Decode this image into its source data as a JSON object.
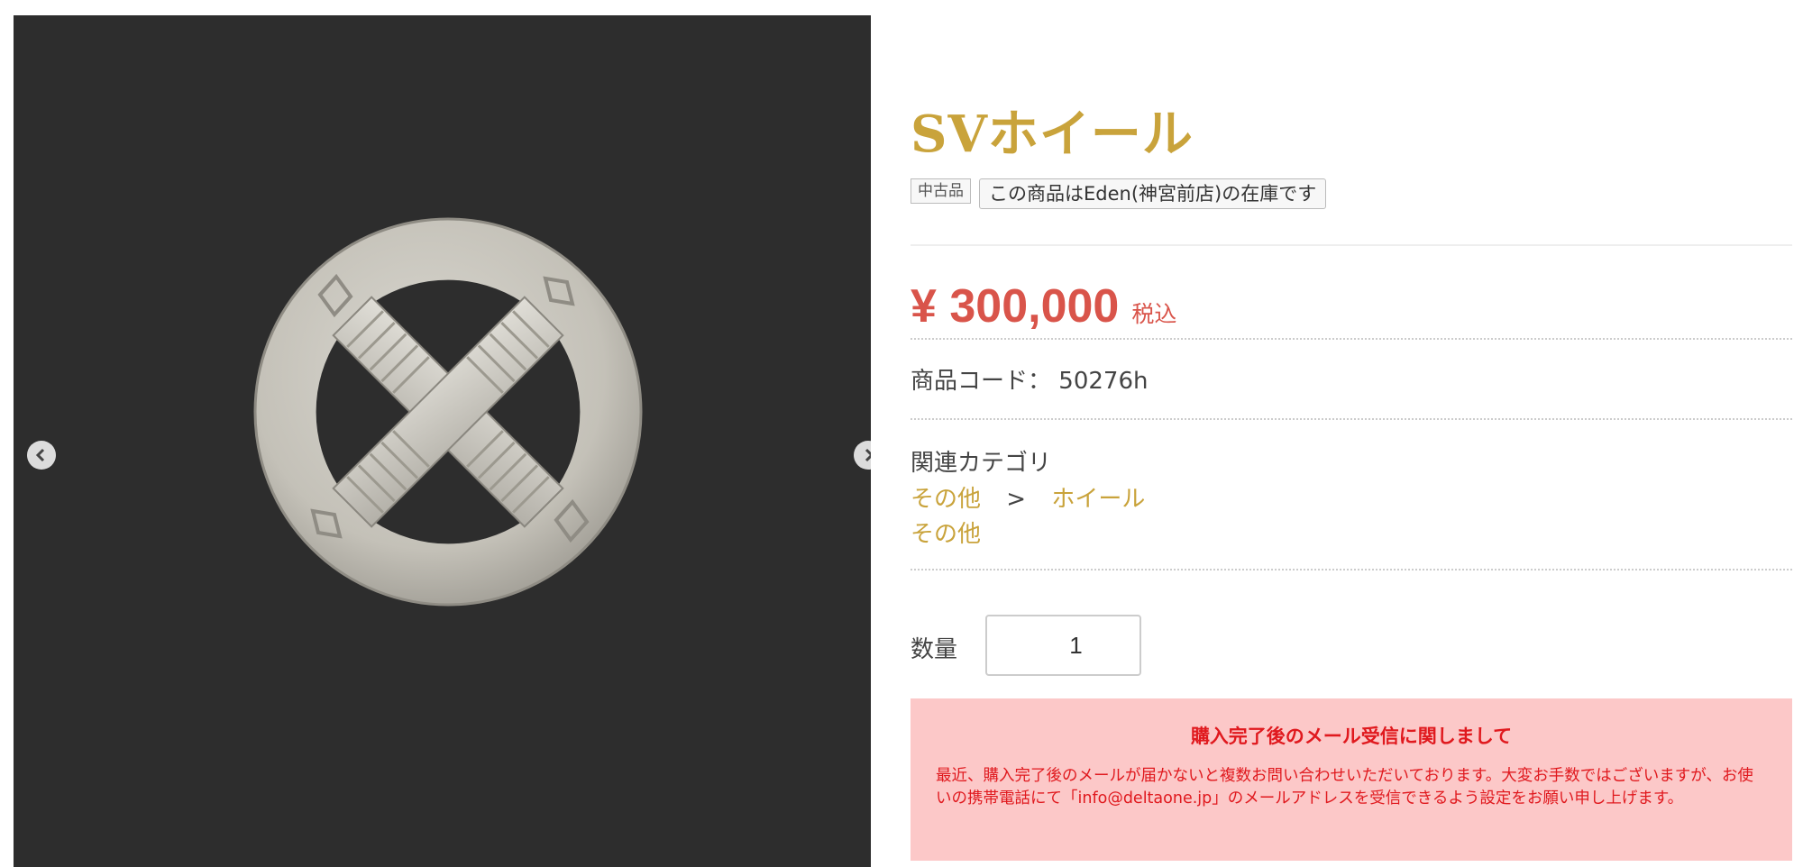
{
  "product": {
    "title": "SVホイール",
    "condition_badge": "中古品",
    "stock_badge": "この商品はEden(神宮前店)の在庫です",
    "price": "¥ 300,000",
    "tax_label": "税込",
    "code_label": "商品コード：",
    "code_value": "50276h"
  },
  "categories": {
    "label": "関連カテゴリ",
    "path": [
      "その他",
      "ホイール"
    ],
    "separator": ">",
    "other": "その他"
  },
  "quantity": {
    "label": "数量",
    "value": "1"
  },
  "notice": {
    "title": "購入完了後のメール受信に関しまして",
    "body": "最近、購入完了後のメールが届かないと複数お問い合わせいただいております。大変お手数ではございますが、お使いの携帯電話にて「info@deltaone.jp」のメールアドレスを受信できるよう設定をお願い申し上げます。"
  },
  "gallery": {
    "prev_icon": "chevron-left-icon",
    "next_icon": "chevron-right-icon"
  },
  "colors": {
    "accent_gold": "#c9a33b",
    "price_red": "#d9544a",
    "notice_bg": "#fcc8c8",
    "notice_text": "#e0191e"
  }
}
